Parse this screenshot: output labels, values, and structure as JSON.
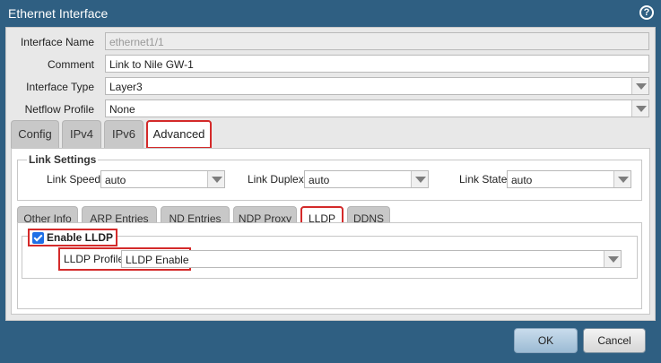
{
  "window": {
    "title": "Ethernet Interface",
    "help_icon": "?"
  },
  "form": {
    "interface_name": {
      "label": "Interface Name",
      "value": "ethernet1/1"
    },
    "comment": {
      "label": "Comment",
      "value": "Link to Nile GW-1"
    },
    "interface_type": {
      "label": "Interface Type",
      "value": "Layer3"
    },
    "netflow_profile": {
      "label": "Netflow Profile",
      "value": "None"
    }
  },
  "main_tabs": [
    "Config",
    "IPv4",
    "IPv6",
    "Advanced"
  ],
  "link_settings": {
    "legend": "Link Settings",
    "speed": {
      "label": "Link Speed",
      "value": "auto"
    },
    "duplex": {
      "label": "Link Duplex",
      "value": "auto"
    },
    "state": {
      "label": "Link State",
      "value": "auto"
    }
  },
  "sub_tabs": [
    "Other Info",
    "ARP Entries",
    "ND Entries",
    "NDP Proxy",
    "LLDP",
    "DDNS"
  ],
  "lldp": {
    "enable_label": "Enable LLDP",
    "enabled": true,
    "profile_label": "LLDP Profile",
    "profile_value": "LLDP Enable"
  },
  "buttons": {
    "ok": "OK",
    "cancel": "Cancel"
  },
  "colors": {
    "titlebar": "#2f5f82",
    "highlight": "#d42a2a",
    "checkbox": "#1f6fe6"
  }
}
